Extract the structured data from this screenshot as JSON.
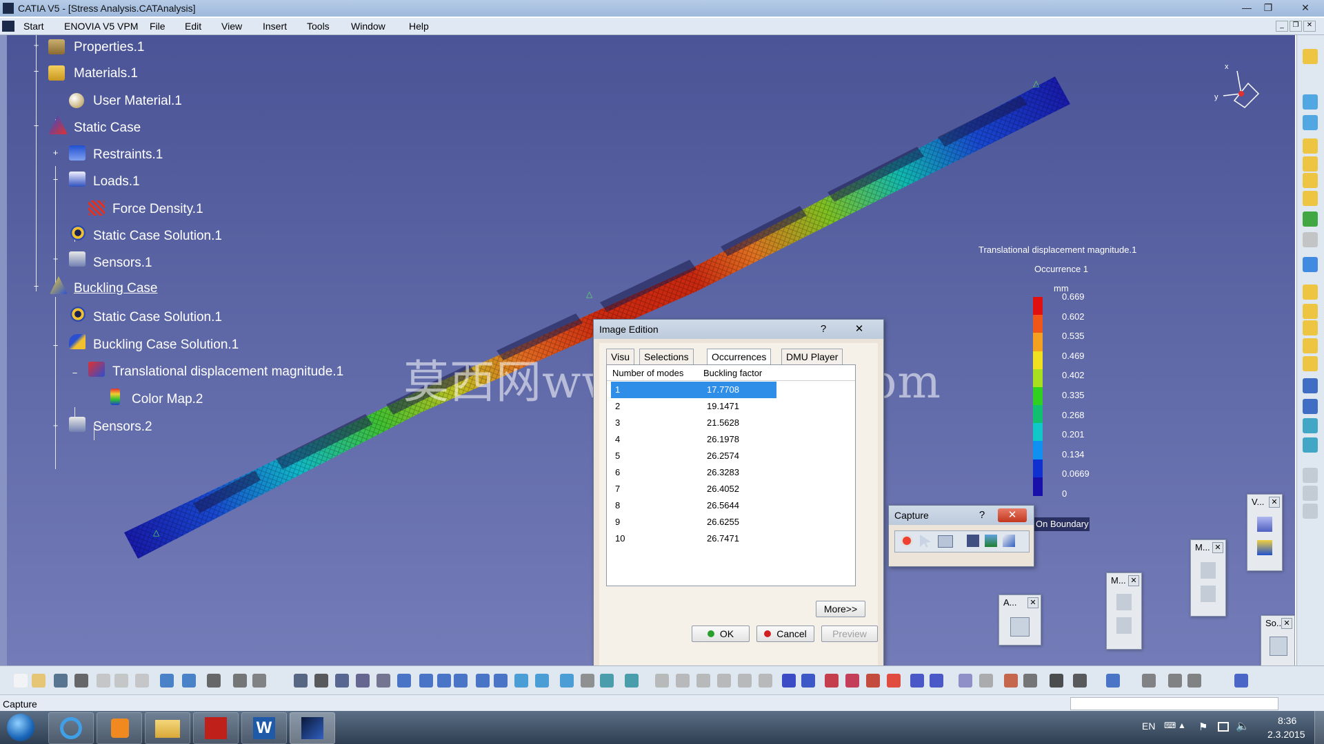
{
  "window": {
    "title": "CATIA V5 - [Stress Analysis.CATAnalysis]"
  },
  "menu": [
    "Start",
    "ENOVIA V5 VPM",
    "File",
    "Edit",
    "View",
    "Insert",
    "Tools",
    "Window",
    "Help"
  ],
  "tree": [
    {
      "label": "Properties.1",
      "icon": "properties-icon"
    },
    {
      "label": "Materials.1",
      "icon": "folder-icon"
    },
    {
      "label": "User Material.1",
      "icon": "material-icon"
    },
    {
      "label": "Static Case",
      "icon": "static-case-icon"
    },
    {
      "label": "Restraints.1",
      "icon": "restraints-icon"
    },
    {
      "label": "Loads.1",
      "icon": "loads-icon"
    },
    {
      "label": "Force Density.1",
      "icon": "force-density-icon"
    },
    {
      "label": "Static Case Solution.1",
      "icon": "solution-gear-icon"
    },
    {
      "label": "Sensors.1",
      "icon": "sensors-icon"
    },
    {
      "label": "Buckling Case",
      "icon": "buckling-case-icon"
    },
    {
      "label": "Static Case Solution.1",
      "icon": "solution-gear-icon"
    },
    {
      "label": "Buckling Case Solution.1",
      "icon": "buckling-solution-icon"
    },
    {
      "label": "Translational displacement magnitude.1",
      "icon": "displacement-image-icon"
    },
    {
      "label": "Color Map.2",
      "icon": "color-map-icon"
    },
    {
      "label": "Sensors.2",
      "icon": "sensors-icon"
    }
  ],
  "watermark": "莫西网www.3dmex.com",
  "legend": {
    "title": "Translational displacement magnitude.1",
    "occurrence": "Occurrence 1",
    "unit": "mm",
    "values": [
      "0.669",
      "0.602",
      "0.535",
      "0.469",
      "0.402",
      "0.335",
      "0.268",
      "0.201",
      "0.134",
      "0.0669",
      "0"
    ],
    "colors": [
      "#e01010",
      "#f0551a",
      "#f4a020",
      "#f0e020",
      "#a8e020",
      "#30d020",
      "#10c070",
      "#10c8c8",
      "#1090f0",
      "#1030d0",
      "#1810a8"
    ],
    "footer": "On Boundary"
  },
  "image_edition": {
    "title": "Image Edition",
    "help": "?",
    "close": "✕",
    "tabs": [
      "Visu",
      "Selections",
      "Occurrences",
      "DMU Player"
    ],
    "columns": [
      "Number of modes",
      "Buckling factor"
    ],
    "rows": [
      {
        "n": "1",
        "f": "17.7708"
      },
      {
        "n": "2",
        "f": "19.1471"
      },
      {
        "n": "3",
        "f": "21.5628"
      },
      {
        "n": "4",
        "f": "26.1978"
      },
      {
        "n": "5",
        "f": "26.2574"
      },
      {
        "n": "6",
        "f": "26.3283"
      },
      {
        "n": "7",
        "f": "26.4052"
      },
      {
        "n": "8",
        "f": "26.5644"
      },
      {
        "n": "9",
        "f": "26.6255"
      },
      {
        "n": "10",
        "f": "26.7471"
      }
    ],
    "more": "More>>",
    "ok": "OK",
    "cancel": "Cancel",
    "preview": "Preview"
  },
  "capture": {
    "title": "Capture",
    "help": "?",
    "close": "✕"
  },
  "mini_toolbars": [
    {
      "title": "A..."
    },
    {
      "title": "M..."
    },
    {
      "title": "M..."
    },
    {
      "title": "V..."
    },
    {
      "title": "So..."
    }
  ],
  "compass": {
    "x": "x",
    "y": "y"
  },
  "status": {
    "text": "Capture"
  },
  "taskbar": {
    "lang": "EN",
    "time": "8:36",
    "date": "2.3.2015"
  }
}
